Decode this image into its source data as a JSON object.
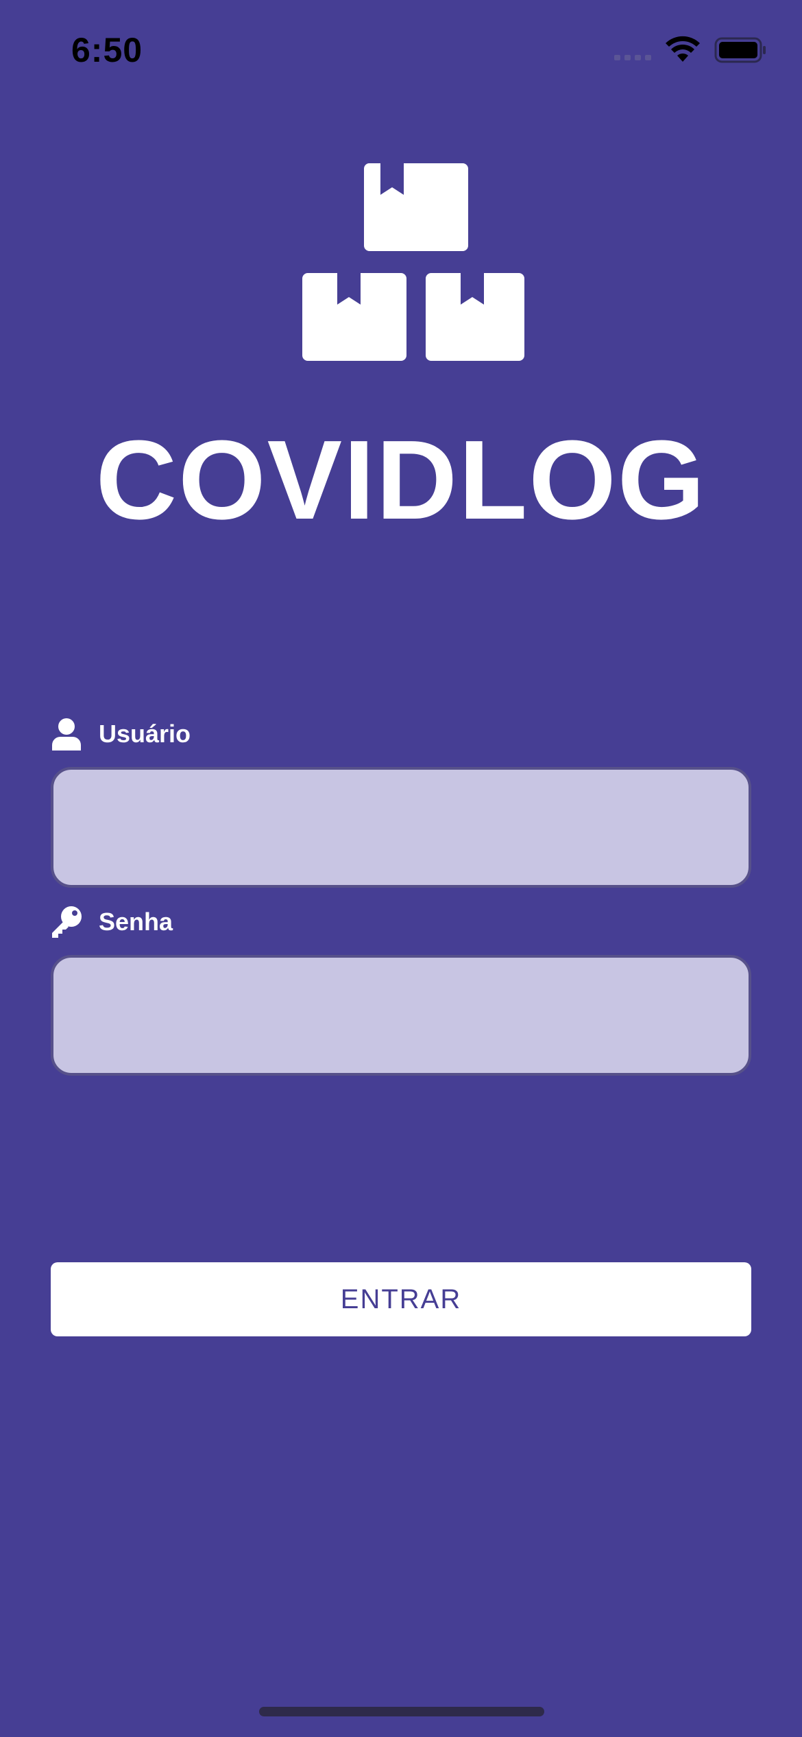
{
  "status_bar": {
    "time": "6:50",
    "icons": [
      "cellular-signal-icon",
      "wifi-icon",
      "battery-icon"
    ]
  },
  "app": {
    "logo_icon": "boxes-icon",
    "title": "COVIDLOG"
  },
  "form": {
    "username": {
      "icon": "user-icon",
      "label": "Usuário",
      "value": "",
      "placeholder": ""
    },
    "password": {
      "icon": "key-icon",
      "label": "Senha",
      "value": "",
      "placeholder": ""
    },
    "submit_label": "ENTRAR"
  },
  "colors": {
    "background": "#463e94",
    "input_fill": "#c8c5e3",
    "input_border": "#57518a",
    "button_fill": "#ffffff",
    "button_text": "#463e94"
  }
}
